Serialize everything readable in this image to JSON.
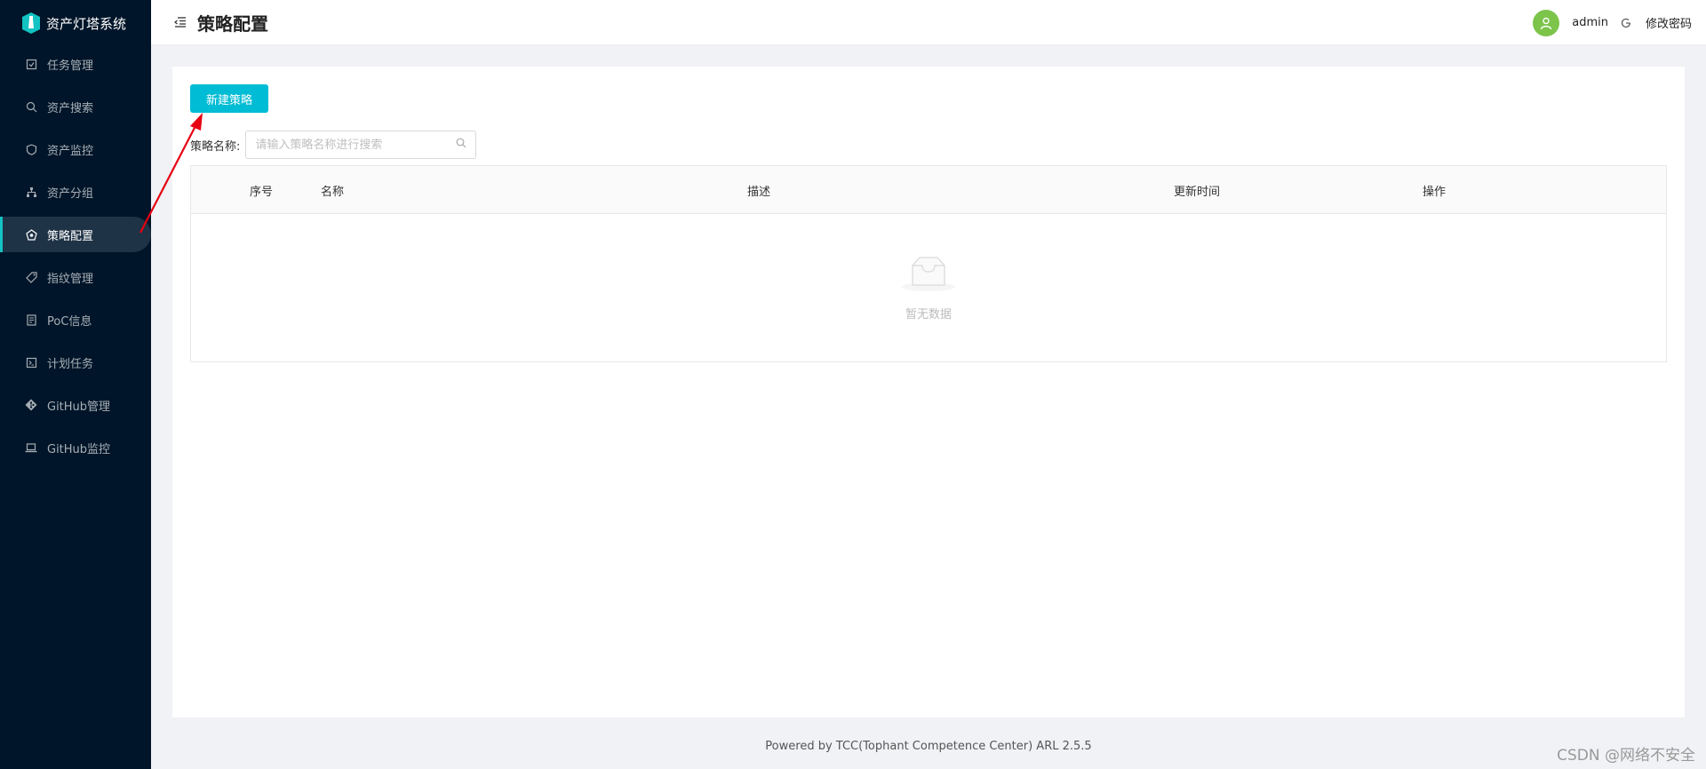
{
  "app": {
    "title": "资产灯塔系统"
  },
  "sidebar": {
    "items": [
      {
        "label": "任务管理",
        "icon": "task-check-icon"
      },
      {
        "label": "资产搜索",
        "icon": "search-icon"
      },
      {
        "label": "资产监控",
        "icon": "shield-icon"
      },
      {
        "label": "资产分组",
        "icon": "cluster-icon"
      },
      {
        "label": "策略配置",
        "icon": "strategy-icon",
        "active": true
      },
      {
        "label": "指纹管理",
        "icon": "tag-icon"
      },
      {
        "label": "PoC信息",
        "icon": "file-icon"
      },
      {
        "label": "计划任务",
        "icon": "code-icon"
      },
      {
        "label": "GitHub管理",
        "icon": "github-icon"
      },
      {
        "label": "GitHub监控",
        "icon": "laptop-icon"
      }
    ]
  },
  "header": {
    "title": "策略配置",
    "username": "admin",
    "change_password": "修改密码"
  },
  "toolbar": {
    "new_label": "新建策略"
  },
  "filter": {
    "label": "策略名称:",
    "placeholder": "请输入策略名称进行搜索"
  },
  "table": {
    "columns": [
      "序号",
      "名称",
      "描述",
      "更新时间",
      "操作"
    ],
    "rows": [],
    "empty_text": "暂无数据"
  },
  "footer": {
    "text": "Powered by TCC(Tophant Competence Center) ARL 2.5.5"
  },
  "watermark": {
    "text": "CSDN @网络不安全"
  },
  "colors": {
    "sidebar_bg": "#001529",
    "accent": "#00bcd4",
    "avatar": "#7cc44a"
  }
}
